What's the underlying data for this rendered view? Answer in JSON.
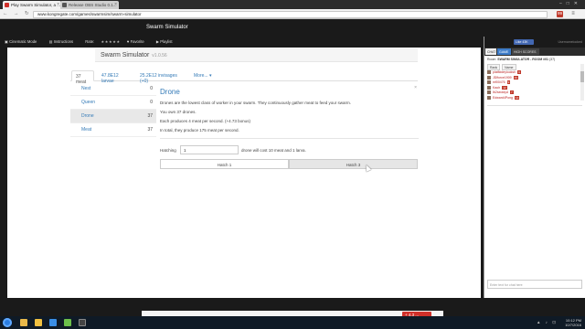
{
  "browser": {
    "tabs": [
      {
        "label": "Play Swarm Simulator, a ..."
      },
      {
        "label": "Release OBS Studio 0.1..."
      }
    ],
    "url": "www.kongregate.com/games/swarmsim/swarm-simulator",
    "nav_glyphs": "← → ↻",
    "window_glyphs": "–□✕",
    "tab_close": "×",
    "ext_label": "99",
    "menu_glyph": "≡"
  },
  "kong": {
    "game_title": "Swarm Simulator",
    "tools": {
      "cinematic": "Cinematic Mode",
      "instructions": "Instructions",
      "rate": "Rate:",
      "stars": "★★★★★",
      "favorite": "Favorite",
      "playlist": "Playlist"
    }
  },
  "game": {
    "name": "Swarm Simulator",
    "version": "v1.0.56",
    "tabs": [
      {
        "label": "37 meat"
      },
      {
        "label": "47.8E12 larvae"
      },
      {
        "label": "25.2E12 invisages (+0)"
      },
      {
        "label": "More... ▾"
      }
    ],
    "units": [
      {
        "name": "Nest",
        "count": "0"
      },
      {
        "name": "Queen",
        "count": "0"
      },
      {
        "name": "Drone",
        "count": "37"
      },
      {
        "name": "Meat",
        "count": "37"
      }
    ],
    "detail": {
      "title": "Drone",
      "close": "×",
      "desc": "Drones are the lowest class of worker in your swarm. They continuously gather meat to feed your swarm.",
      "own": "You own 37 drones.",
      "produces": "Each produces 4 meat per second. (+4.73 bonus)",
      "total": "In total, they produce 175 meat per second."
    },
    "hatch": {
      "label": "Hatching",
      "value": "1",
      "cost": "drone will cost 10 meat and 1 larva.",
      "btn1": "Hatch 1",
      "btn2": "Hatch 3"
    }
  },
  "chat": {
    "like": "Like 43K",
    "user_link": "Usernamelooked",
    "tabs": [
      {
        "label": "CHAT"
      },
      {
        "label": "GAME"
      },
      {
        "label": "HIGH SCORES"
      }
    ],
    "room_prefix": "Room:",
    "room_name": "SWARM SIMULATOR - ROOM #01",
    "room_count": "(37)",
    "sort": [
      {
        "label": "Rank"
      },
      {
        "label": "Name"
      }
    ],
    "users": [
      {
        "name": "platfiddeylooksh",
        "level": "9"
      },
      {
        "name": "JDlforce1909",
        "level": "19"
      },
      {
        "name": "mf00476",
        "level": "9"
      },
      {
        "name": "Kaoh",
        "level": "12"
      },
      {
        "name": "Ib2seoldyd",
        "level": "7"
      },
      {
        "name": "Edward4Pong",
        "level": "14"
      }
    ],
    "input_placeholder": "Enter text for chat here"
  },
  "footer": {
    "promo": "+ 4.3 ..."
  },
  "taskbar": {
    "time": "10:12 PM",
    "date": "10/7/2016",
    "tray_icons": "▲ ♪ ⊡"
  },
  "colors": {
    "link": "#337ab7",
    "kong_red": "#c0392b",
    "facebook": "#4267b2"
  }
}
